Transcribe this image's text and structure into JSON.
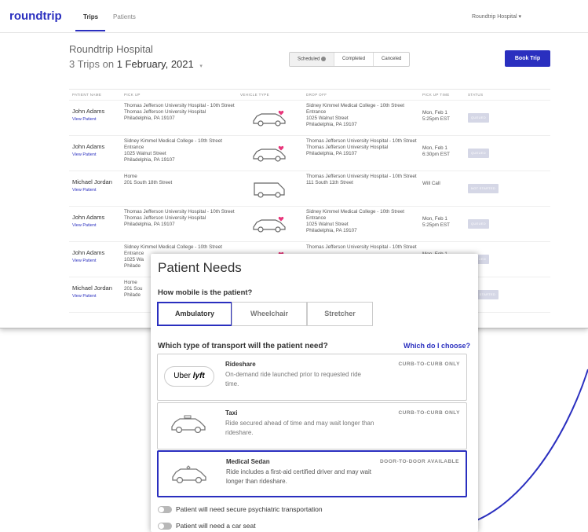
{
  "brand": "roundtrip",
  "nav": {
    "tabs": [
      "Trips",
      "Patients"
    ],
    "hospital_menu": "Roundtrip Hospital ▾"
  },
  "header": {
    "hospital": "Roundtrip Hospital",
    "trips_prefix": "3 Trips on ",
    "date": "1 February, 2021",
    "date_caret": "▾",
    "filters": [
      "Scheduled",
      "Completed",
      "Canceled"
    ],
    "book_button": "Book Trip"
  },
  "table": {
    "columns": [
      "PATIENT NAME",
      "PICK UP",
      "VEHICLE TYPE",
      "DROP OFF",
      "PICK UP TIME",
      "STATUS"
    ],
    "rows": [
      {
        "name": "John Adams",
        "link": "View Patient",
        "pickup": "Thomas Jefferson University Hospital - 10th Street\nThomas Jefferson University Hospital\nPhiladelphia, PA 19107",
        "dropoff": "Sidney Kimmel Medical College - 10th Street Entrance\n1025 Walnut Street\nPhiladelphia, PA 19107",
        "time": "Mon, Feb 1\n5:25pm EST",
        "status": "QUEUED",
        "vehicle": "sedan"
      },
      {
        "name": "John Adams",
        "link": "View Patient",
        "pickup": "Sidney Kimmel Medical College - 10th Street Entrance\n1025 Walnut Street\nPhiladelphia, PA 19107",
        "dropoff": "Thomas Jefferson University Hospital - 10th Street\nThomas Jefferson University Hospital\nPhiladelphia, PA 19107",
        "time": "Mon, Feb 1\n6:30pm EST",
        "status": "QUEUED",
        "vehicle": "sedan"
      },
      {
        "name": "Michael Jordan",
        "link": "View Patient",
        "pickup": "Home\n201 South 18th Street",
        "dropoff": "Thomas Jefferson University Hospital - 10th Street\n111 South 11th Street",
        "time": "Will Call",
        "status": "NOT STARTED",
        "vehicle": "van"
      },
      {
        "name": "John Adams",
        "link": "View Patient",
        "pickup": "Thomas Jefferson University Hospital - 10th Street\nThomas Jefferson University Hospital\nPhiladelphia, PA 19107",
        "dropoff": "Sidney Kimmel Medical College - 10th Street Entrance\n1025 Walnut Street\nPhiladelphia, PA 19107",
        "time": "Mon, Feb 1\n5:25pm EST",
        "status": "QUEUED",
        "vehicle": "sedan"
      },
      {
        "name": "John Adams",
        "link": "View Patient",
        "pickup": "Sidney Kimmel Medical College - 10th Street Entrance\n1025 Wa\nPhilade",
        "dropoff": "Thomas Jefferson University Hospital - 10th Street",
        "time": "Mon, Feb 1",
        "status": "QUEUED",
        "vehicle": "sedan"
      },
      {
        "name": "Michael Jordan",
        "link": "View Patient",
        "pickup": "Home\n201 Sou\nPhilade",
        "dropoff": "",
        "time": "",
        "status": "NOT STARTED",
        "vehicle": ""
      }
    ]
  },
  "modal": {
    "title": "Patient Needs",
    "mobility_question": "How mobile is the patient?",
    "mobility_options": [
      "Ambulatory",
      "Wheelchair",
      "Stretcher"
    ],
    "transport_question": "Which type of transport will the patient need?",
    "which_link": "Which do I choose?",
    "options": [
      {
        "title": "Rideshare",
        "desc": "On-demand ride launched prior to requested ride time.",
        "tag": "CURB-TO-CURB ONLY",
        "logo_uber": "Uber",
        "logo_lyft": "lyft"
      },
      {
        "title": "Taxi",
        "desc": "Ride secured ahead of time and may wait longer than rideshare.",
        "tag": "CURB-TO-CURB ONLY"
      },
      {
        "title": "Medical Sedan",
        "desc": "Ride includes a first-aid certified driver and may wait longer than rideshare.",
        "tag": "DOOR-TO-DOOR AVAILABLE"
      }
    ],
    "toggles": [
      "Patient will need secure psychiatric transportation",
      "Patient will need a car seat"
    ]
  },
  "colors": {
    "accent": "#2a2fbf",
    "heart": "#e8357a",
    "status_bg": "#d5d7e6"
  }
}
